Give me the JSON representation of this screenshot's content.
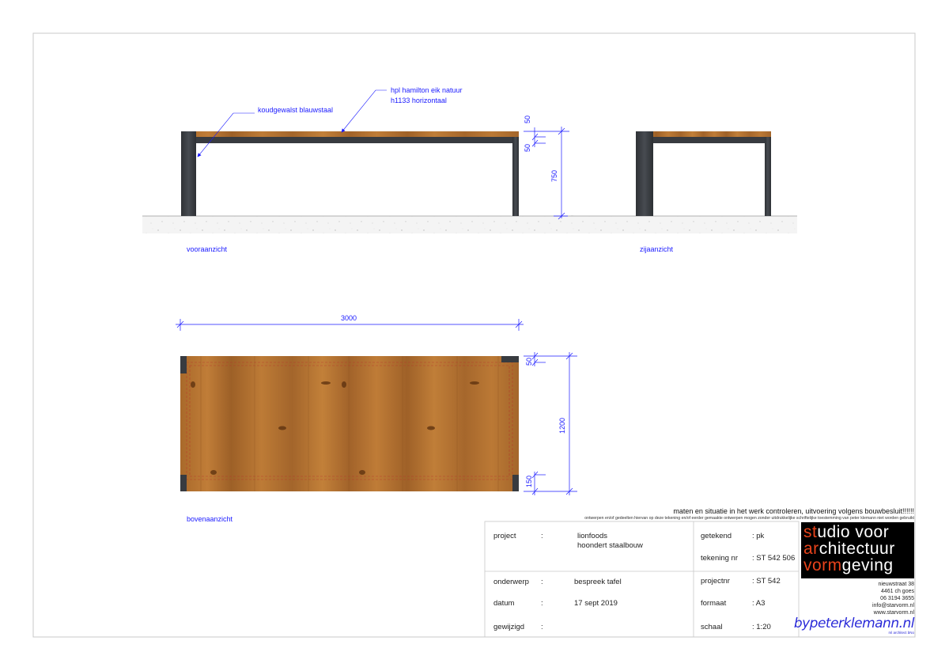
{
  "annotations": {
    "steel": "koudgewalst blauwstaal",
    "hpl_line1": "hpl hamilton eik natuur",
    "hpl_line2": "h1133 horizontaal"
  },
  "dimensions": {
    "top_thickness": "50",
    "frame_thickness": "50",
    "height": "750",
    "length": "3000",
    "top_overhang": "50",
    "width": "1200",
    "bottom_inset": "150"
  },
  "views": {
    "front": "vooraanzicht",
    "side": "zijaanzicht",
    "top": "bovenaanzicht"
  },
  "notice": {
    "main": "maten en situatie in het werk controleren, uitvoering volgens bouwbesluit!!!!!!",
    "small": "ontwerpen en/of gedeelten hiervan op deze tekening en/of eerder gemaakte ontwerpen mogen zonder uitdrukkelijke schriftelijke toestemming van peter klemann niet worden gebruikt"
  },
  "title_block": {
    "project_label": "project",
    "project_value_1": "lionfoods",
    "project_value_2": "hoondert staalbouw",
    "onderwerp_label": "onderwerp",
    "onderwerp_value": "bespreek tafel",
    "datum_label": "datum",
    "datum_value": "17 sept 2019",
    "gewijzigd_label": "gewijzigd",
    "gewijzigd_value": "",
    "colon": ":",
    "getekend_label": "getekend",
    "getekend_value": ": pk",
    "tekening_label": "tekening nr",
    "tekening_value": ": ST 542 506",
    "projectnr_label": "projectnr",
    "projectnr_value": ": ST 542",
    "formaat_label": "formaat",
    "formaat_value": ": A3",
    "schaal_label": "schaal",
    "schaal_value": ": 1:20"
  },
  "studio": {
    "line1_accent": "st",
    "line1_rest": "udio voor",
    "line2_accent": "ar",
    "line2_rest": "chitectuur",
    "line3_accent": "vorm",
    "line3_rest": "geving",
    "address1": "nieuwstraat 38",
    "address2": "4461 ch goes",
    "phone": "06 3194 3655",
    "email": "info@starvorm.nl",
    "web": "www.starvorm.nl",
    "signature": "bypeterklemann.nl",
    "signature_sub": "ml architect bNo"
  },
  "colors": {
    "annotation_blue": "#1a1aff",
    "steel": "#3a3d42",
    "wood": "#b8762f",
    "studio_accent": "#e8431b",
    "signature_blue": "#2a2ad8"
  }
}
